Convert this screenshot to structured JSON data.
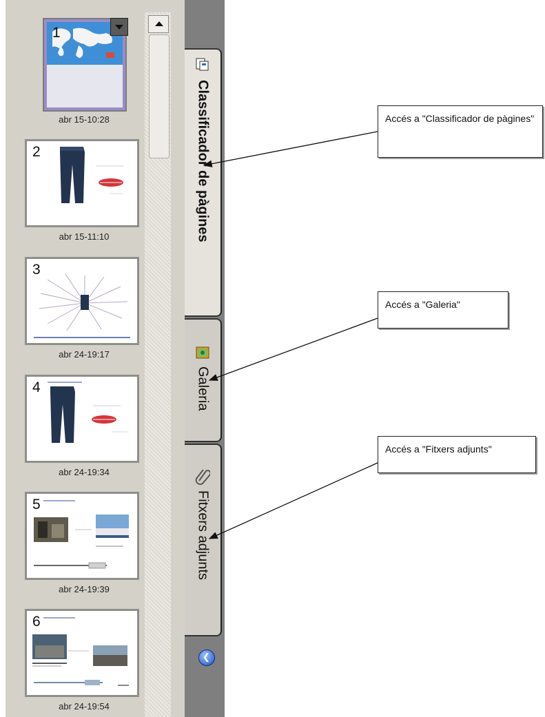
{
  "page_sorter": {
    "pages": [
      {
        "number": "1",
        "time": "abr 15-10:28",
        "selected": true
      },
      {
        "number": "2",
        "time": "abr 15-11:10",
        "selected": false
      },
      {
        "number": "3",
        "time": "abr 24-19:17",
        "selected": false
      },
      {
        "number": "4",
        "time": "abr 24-19:34",
        "selected": false
      },
      {
        "number": "5",
        "time": "abr 24-19:39",
        "selected": false
      },
      {
        "number": "6",
        "time": "abr 24-19:54",
        "selected": false
      }
    ]
  },
  "tabs": [
    {
      "label": "Classificador de pàgines",
      "active": true,
      "icon": "page-sorter-icon"
    },
    {
      "label": "Galeria",
      "active": false,
      "icon": "gallery-icon"
    },
    {
      "label": "Fitxers adjunts",
      "active": false,
      "icon": "paperclip-icon"
    }
  ],
  "callouts": [
    {
      "text": "Accés a \"Classificador de pàgines\""
    },
    {
      "text": "Accés a \"Galeria\""
    },
    {
      "text": "Accés a \"Fitxers adjunts\""
    }
  ],
  "colors": {
    "panel_bg": "#d4d2c8",
    "tab_strip": "#7f7f7f",
    "selected_border": "#9b8cc8"
  }
}
